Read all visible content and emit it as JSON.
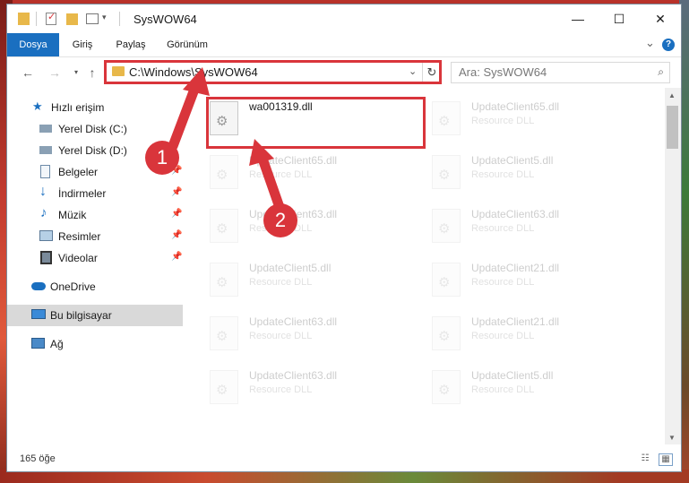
{
  "window": {
    "title": "SysWOW64",
    "minimize_glyph": "—",
    "maximize_glyph": "☐",
    "close_glyph": "✕"
  },
  "ribbon": {
    "tabs": [
      "Dosya",
      "Giriş",
      "Paylaş",
      "Görünüm"
    ],
    "collapse_glyph": "⌄",
    "help_glyph": "?"
  },
  "address": {
    "path": "C:\\Windows\\SysWOW64",
    "search_placeholder": "Ara: SysWOW64"
  },
  "nav": {
    "quick_access": "Hızlı erişim",
    "items": [
      {
        "label": "Yerel Disk (C:)",
        "icon": "drive-icon"
      },
      {
        "label": "Yerel Disk (D:)",
        "icon": "drive-icon"
      },
      {
        "label": "Belgeler",
        "icon": "documents-icon"
      },
      {
        "label": "İndirmeler",
        "icon": "downloads-icon"
      },
      {
        "label": "Müzik",
        "icon": "music-icon"
      },
      {
        "label": "Resimler",
        "icon": "pictures-icon"
      },
      {
        "label": "Videolar",
        "icon": "videos-icon"
      }
    ],
    "onedrive": "OneDrive",
    "this_pc": "Bu bilgisayar",
    "network": "Ağ"
  },
  "files": [
    {
      "name": "wa001319.dll",
      "type": ""
    },
    {
      "name": "UpdateClient65.dll",
      "type": "Resource DLL"
    },
    {
      "name": "UpdateClient65.dll",
      "type": "Resource DLL"
    },
    {
      "name": "UpdateClient5.dll",
      "type": "Resource DLL"
    },
    {
      "name": "UpdateClient63.dll",
      "type": "Resource DLL"
    },
    {
      "name": "UpdateClient63.dll",
      "type": "Resource DLL"
    },
    {
      "name": "UpdateClient5.dll",
      "type": "Resource DLL"
    },
    {
      "name": "UpdateClient21.dll",
      "type": "Resource DLL"
    },
    {
      "name": "UpdateClient63.dll",
      "type": "Resource DLL"
    },
    {
      "name": "UpdateClient21.dll",
      "type": "Resource DLL"
    },
    {
      "name": "UpdateClient63.dll",
      "type": "Resource DLL"
    },
    {
      "name": "UpdateClient5.dll",
      "type": "Resource DLL"
    }
  ],
  "status": {
    "item_count": "165 öğe"
  },
  "annotations": {
    "step1": "1",
    "step2": "2",
    "color": "#d9353b"
  },
  "colors": {
    "accent": "#1a6fc0",
    "folder": "#e8b84a"
  }
}
